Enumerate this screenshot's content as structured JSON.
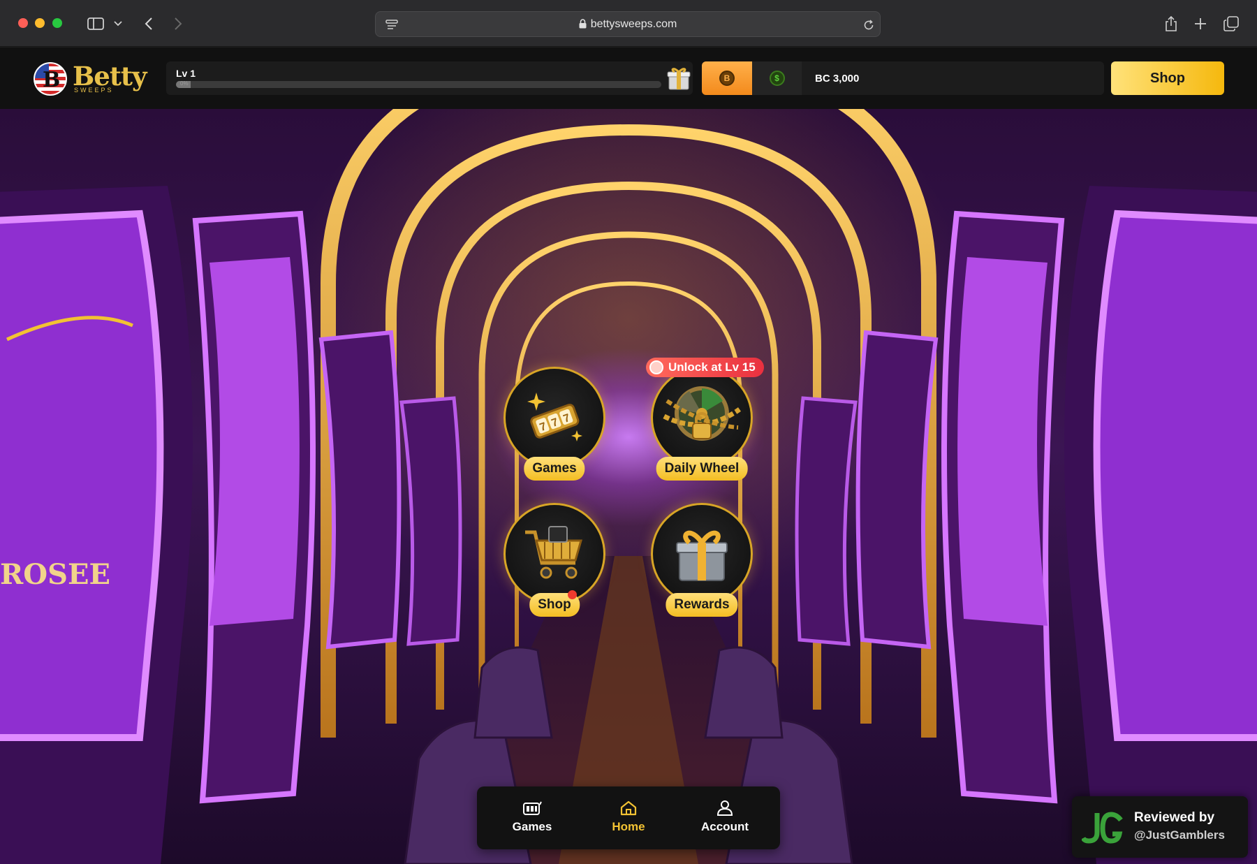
{
  "browser": {
    "url": "bettysweeps.com"
  },
  "brand": {
    "name": "Betty",
    "tagline": "SWEEPS"
  },
  "level": {
    "label": "Lv 1",
    "progress_text": "0%",
    "progress": 0.03
  },
  "wallet": {
    "balance": "BC 3,000"
  },
  "header": {
    "shop_label": "Shop"
  },
  "tiles": [
    {
      "label": "Games",
      "icon": "slot-reels-icon"
    },
    {
      "label": "Daily Wheel",
      "icon": "locked-wheel-icon",
      "badge": "Unlock at Lv 15"
    },
    {
      "label": "Shop",
      "icon": "shopping-cart-icon"
    },
    {
      "label": "Rewards",
      "icon": "gift-box-icon"
    }
  ],
  "bottom_nav": [
    {
      "label": "Games",
      "icon": "games-icon",
      "active": false
    },
    {
      "label": "Home",
      "icon": "home-icon",
      "active": true
    },
    {
      "label": "Account",
      "icon": "account-icon",
      "active": false
    }
  ],
  "review": {
    "line1": "Reviewed by",
    "line2": "@JustGamblers"
  },
  "colors": {
    "accent_gold": "#f5b80d",
    "accent_orange": "#f38a1c",
    "badge_red": "#e9303f",
    "hero_purple": "#7a2bb0"
  }
}
